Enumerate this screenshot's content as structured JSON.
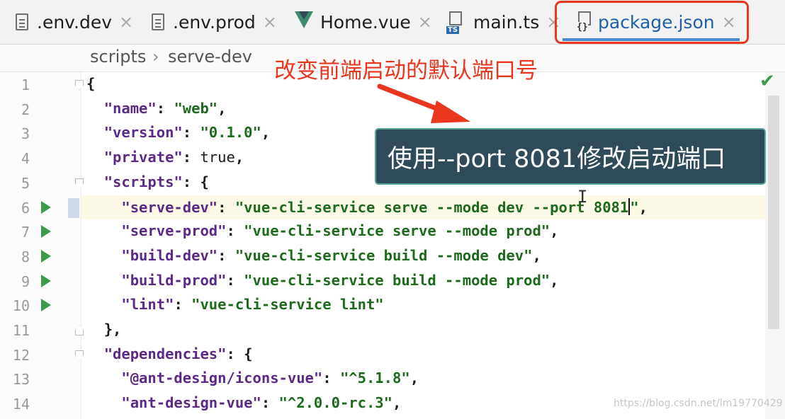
{
  "tabs": [
    {
      "name": ".env.dev",
      "icon": "text-file-icon",
      "close": "×"
    },
    {
      "name": ".env.prod",
      "icon": "text-file-icon",
      "close": "×"
    },
    {
      "name": "Home.vue",
      "icon": "vue-file-icon",
      "close": "×"
    },
    {
      "name": "main.ts",
      "icon": "typescript-file-icon",
      "icon_label": "TS",
      "close": "×"
    },
    {
      "name": "package.json",
      "icon": "json-file-icon",
      "icon_label": "{}",
      "close": "×",
      "active": true
    }
  ],
  "breadcrumb": {
    "items": [
      "scripts",
      "serve-dev"
    ],
    "separator": "›"
  },
  "annotation_red": "改变前端启动的默认端口号",
  "tooltip": "使用--port 8081修改启动端口",
  "editor": {
    "cursor_line": 6,
    "check_glyph": "✔",
    "lines": [
      {
        "n": "1",
        "text": "{"
      },
      {
        "n": "2",
        "text": "  \"name\": \"web\","
      },
      {
        "n": "3",
        "text": "  \"version\": \"0.1.0\","
      },
      {
        "n": "4",
        "text": "  \"private\": true,"
      },
      {
        "n": "5",
        "text": "  \"scripts\": {"
      },
      {
        "n": "6",
        "text": "    \"serve-dev\": \"vue-cli-service serve --mode dev --port 8081\","
      },
      {
        "n": "7",
        "text": "    \"serve-prod\": \"vue-cli-service serve --mode prod\","
      },
      {
        "n": "8",
        "text": "    \"build-dev\": \"vue-cli-service build --mode dev\","
      },
      {
        "n": "9",
        "text": "    \"build-prod\": \"vue-cli-service build --mode prod\","
      },
      {
        "n": "10",
        "text": "    \"lint\": \"vue-cli-service lint\""
      },
      {
        "n": "11",
        "text": "  },"
      },
      {
        "n": "12",
        "text": "  \"dependencies\": {"
      },
      {
        "n": "13",
        "text": "    \"@ant-design/icons-vue\": \"^5.1.8\","
      },
      {
        "n": "14",
        "text": "    \"ant-design-vue\": \"^2.0.0-rc.3\","
      }
    ]
  },
  "watermark": "https://blog.csdn.net/lm19770429",
  "colors": {
    "highlight_box": "#e8361f",
    "tooltip_bg": "#2f4a58",
    "string": "#1d6a1d",
    "key": "#5b2a86",
    "keyword": "#0b2fa0",
    "run_icon": "#3d9a4a"
  }
}
